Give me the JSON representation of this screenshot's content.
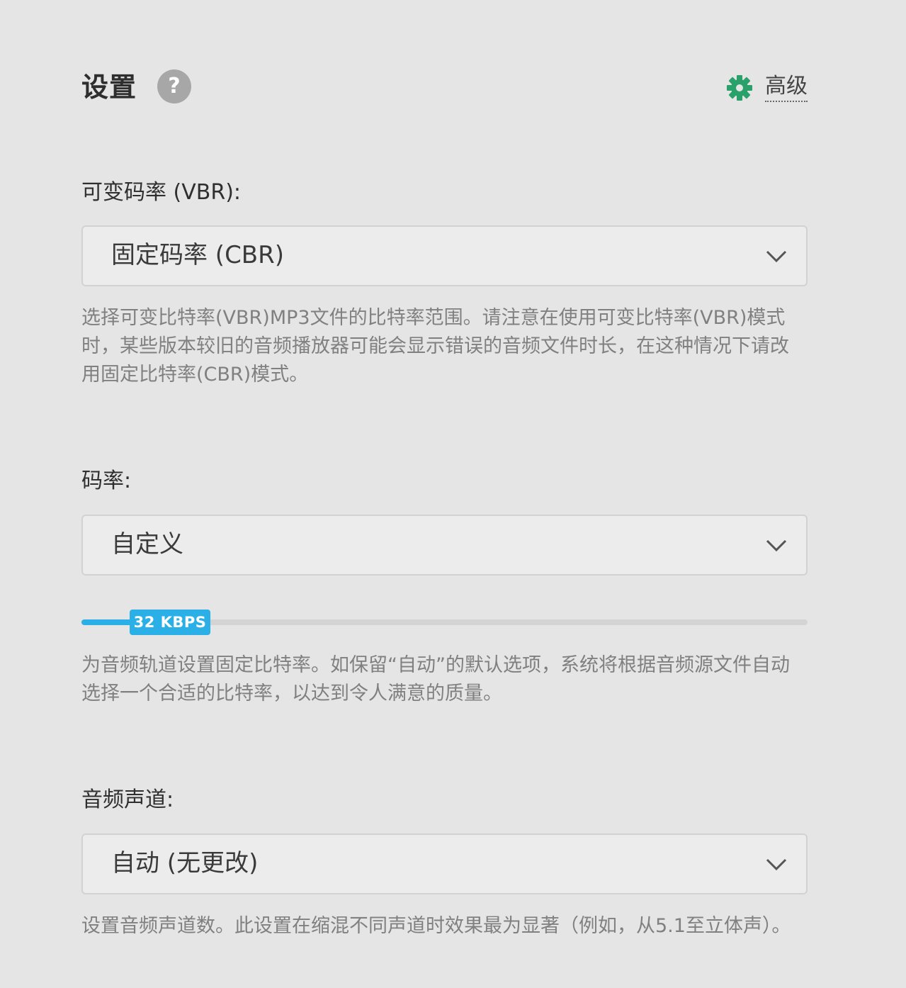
{
  "header": {
    "title": "设置",
    "help_icon": "?",
    "advanced_label": "高级",
    "advanced_icon": "gear-icon",
    "accent_color": "#2aa06a"
  },
  "vbr": {
    "label": "可变码率 (VBR):",
    "selected": "固定码率 (CBR)",
    "help": "选择可变比特率(VBR)MP3文件的比特率范围。请注意在使用可变比特率(VBR)模式时，某些版本较旧的音频播放器可能会显示错误的音频文件时长，在这种情况下请改用固定比特率(CBR)模式。"
  },
  "bitrate": {
    "label": "码率:",
    "selected": "自定义",
    "slider_value": "32 KBPS",
    "slider_color": "#2ab0e6",
    "help": "为音频轨道设置固定比特率。如保留“自动”的默认选项，系统将根据音频源文件自动选择一个合适的比特率，以达到令人满意的质量。"
  },
  "channels": {
    "label": "音频声道:",
    "selected": "自动 (无更改)",
    "help": "设置音频声道数。此设置在缩混不同声道时效果最为显著（例如，从5.1至立体声）。"
  }
}
